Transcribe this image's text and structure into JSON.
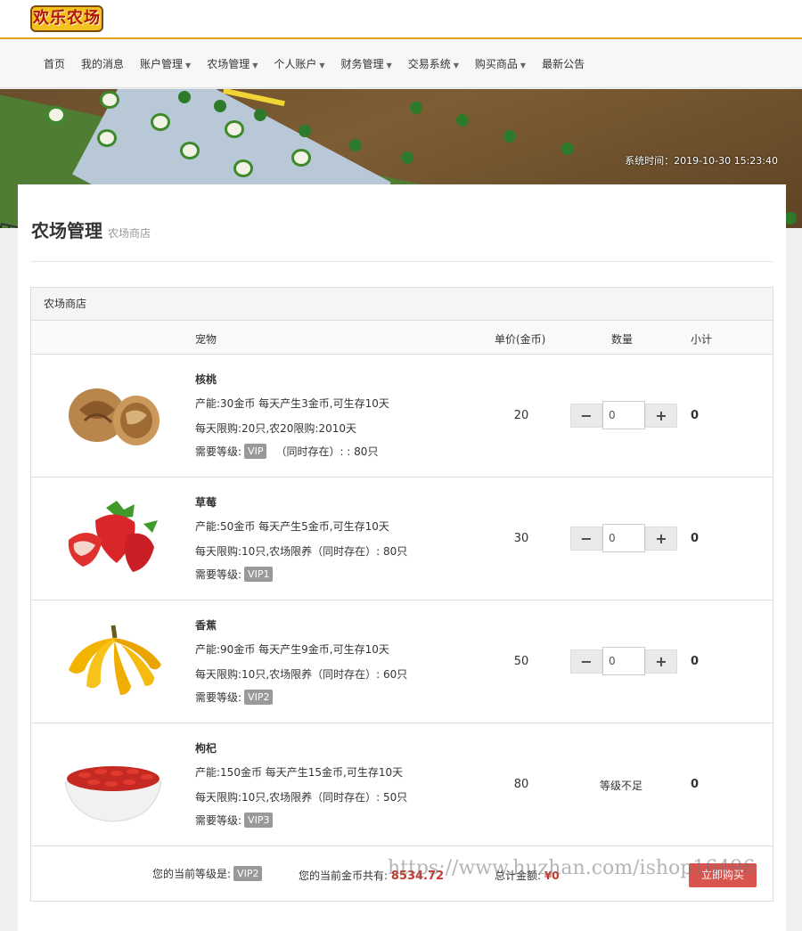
{
  "header": {
    "logo_text": "欢乐农场"
  },
  "nav": {
    "items": [
      {
        "label": "首页",
        "dropdown": false
      },
      {
        "label": "我的消息",
        "dropdown": false
      },
      {
        "label": "账户管理",
        "dropdown": true
      },
      {
        "label": "农场管理",
        "dropdown": true
      },
      {
        "label": "个人账户",
        "dropdown": true
      },
      {
        "label": "财务管理",
        "dropdown": true
      },
      {
        "label": "交易系统",
        "dropdown": true
      },
      {
        "label": "购买商品",
        "dropdown": true
      },
      {
        "label": "最新公告",
        "dropdown": false
      }
    ]
  },
  "banner": {
    "system_time": "系统时间：2019-10-30 15:23:40"
  },
  "page": {
    "title": "农场管理",
    "subtitle": "农场商店"
  },
  "panel": {
    "title": "农场商店",
    "columns": {
      "pet": "宠物",
      "price": "单价(金币)",
      "qty": "数量",
      "subtotal": "小计"
    },
    "level_label": "需要等级:",
    "rows": [
      {
        "name": "核桃",
        "line1": "产能:30金币 每天产生3金币,可生存10天",
        "line2": "每天限购:20只,农20限购:2010天",
        "level": "VIP",
        "level_extra": "（同时存在）: : 80只",
        "price": "20",
        "qty": "0",
        "qty_note": "",
        "subtotal": "0",
        "icon": "walnut-image"
      },
      {
        "name": "草莓",
        "line1": "产能:50金币 每天产生5金币,可生存10天",
        "line2": "每天限购:10只,农场限养（同时存在）: 80只",
        "level": "VIP1",
        "level_extra": "",
        "price": "30",
        "qty": "0",
        "qty_note": "",
        "subtotal": "0",
        "icon": "strawberry-image"
      },
      {
        "name": "香蕉",
        "line1": "产能:90金币 每天产生9金币,可生存10天",
        "line2": "每天限购:10只,农场限养（同时存在）: 60只",
        "level": "VIP2",
        "level_extra": "",
        "price": "50",
        "qty": "0",
        "qty_note": "",
        "subtotal": "0",
        "icon": "banana-image"
      },
      {
        "name": "枸杞",
        "line1": "产能:150金币 每天产生15金币,可生存10天",
        "line2": "每天限购:10只,农场限养（同时存在）: 50只",
        "level": "VIP3",
        "level_extra": "",
        "price": "80",
        "qty": "",
        "qty_note": "等级不足",
        "subtotal": "0",
        "icon": "goji-image"
      }
    ],
    "footer": {
      "current_level_label": "您的当前等级是:",
      "current_level": "VIP2",
      "gold_label": "您的当前金币共有:",
      "gold_value": "8534.72",
      "total_label": "总计金额:",
      "total_value": "¥0",
      "buy_button": "立即购买",
      "watermark": "https://www.huzhan.com/ishop16496"
    }
  },
  "colors": {
    "accent": "#e2a21f",
    "buy": "#d9534f",
    "badge": "#999999"
  }
}
